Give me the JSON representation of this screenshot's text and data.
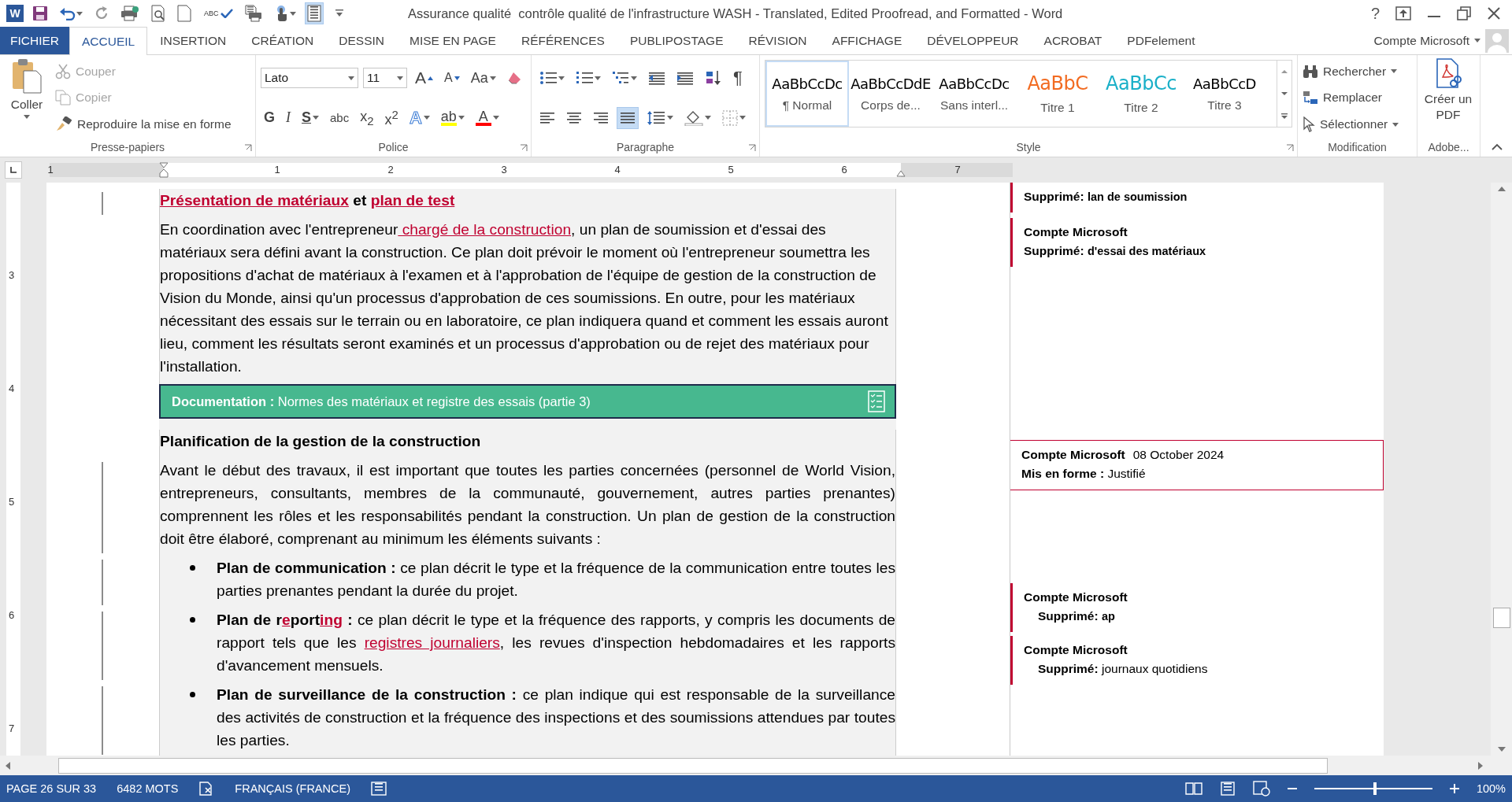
{
  "title_bar": {
    "quick_access": [
      {
        "kind": "word-logo",
        "text": "W",
        "on": false
      },
      {
        "kind": "save",
        "on": false
      },
      {
        "kind": "undo",
        "on": false
      },
      {
        "kind": "redo",
        "on": false
      },
      {
        "kind": "print",
        "on": false
      },
      {
        "kind": "preview",
        "on": false
      },
      {
        "kind": "new",
        "on": false
      },
      {
        "kind": "spelling",
        "text": "ABC",
        "on": false
      },
      {
        "kind": "print-preview",
        "on": false
      },
      {
        "kind": "touch",
        "on": false
      },
      {
        "kind": "layout",
        "on": true
      },
      {
        "kind": "customize",
        "on": false
      }
    ],
    "title": "Assurance qualité  contrôle qualité de l'infrastructure WASH - Translated, Edited Proofread, and Formatted - Word",
    "help": "?"
  },
  "menu_tabs": [
    {
      "label": "FICHIER",
      "kind": "file",
      "selected": false
    },
    {
      "label": "ACCUEIL",
      "kind": "tab",
      "selected": true
    },
    {
      "label": "INSERTION",
      "kind": "tab",
      "selected": false
    },
    {
      "label": "CRÉATION",
      "kind": "tab",
      "selected": false
    },
    {
      "label": "DESSIN",
      "kind": "tab",
      "selected": false
    },
    {
      "label": "MISE EN PAGE",
      "kind": "tab",
      "selected": false
    },
    {
      "label": "RÉFÉRENCES",
      "kind": "tab",
      "selected": false
    },
    {
      "label": "PUBLIPOSTAGE",
      "kind": "tab",
      "selected": false
    },
    {
      "label": "RÉVISION",
      "kind": "tab",
      "selected": false
    },
    {
      "label": "AFFICHAGE",
      "kind": "tab",
      "selected": false
    },
    {
      "label": "DÉVELOPPEUR",
      "kind": "tab",
      "selected": false
    },
    {
      "label": "ACROBAT",
      "kind": "tab",
      "selected": false
    },
    {
      "label": "PDFelement",
      "kind": "tab",
      "selected": false
    }
  ],
  "account": "Compte Microsoft",
  "ribbon": {
    "clipboard": {
      "title": "Presse-papiers",
      "paste": "Coller",
      "items": [
        {
          "kind": "cut",
          "label": "Couper",
          "disabled": true
        },
        {
          "kind": "copy",
          "label": "Copier",
          "disabled": true
        },
        {
          "kind": "format-painter",
          "label": "Reproduire la mise en forme",
          "disabled": false
        }
      ]
    },
    "font": {
      "title": "Police",
      "font_name": "Lato",
      "font_size": "11",
      "tools_top": [
        {
          "kind": "grow",
          "text": "A"
        },
        {
          "kind": "shrink",
          "text": "A"
        },
        {
          "kind": "case",
          "text": "Aa"
        },
        {
          "kind": "clear"
        }
      ],
      "tools_bottom": [
        {
          "kind": "bold",
          "text": "G"
        },
        {
          "kind": "italic",
          "text": "I"
        },
        {
          "kind": "underline",
          "text": "S"
        },
        {
          "kind": "strike",
          "text": "abc"
        },
        {
          "kind": "sub",
          "text": "x$_{2}$"
        },
        {
          "kind": "sup",
          "text": "x$^{2}$"
        },
        {
          "kind": "effects",
          "text": "A"
        },
        {
          "kind": "highlight",
          "text": "ab",
          "color": "#ffff00"
        },
        {
          "kind": "font-color",
          "text": "A",
          "color": "#ff0000"
        }
      ]
    },
    "paragraph": {
      "title": "Paragraphe",
      "tools_top": [
        {
          "kind": "bullets"
        },
        {
          "kind": "numbering"
        },
        {
          "kind": "multilevel"
        },
        {
          "kind": "outdent"
        },
        {
          "kind": "indent"
        },
        {
          "kind": "sort"
        },
        {
          "kind": "pilcrow",
          "text": "¶"
        }
      ],
      "alignment": [
        {
          "kind": "left",
          "selected": false
        },
        {
          "kind": "center",
          "selected": false
        },
        {
          "kind": "right",
          "selected": false
        },
        {
          "kind": "justify",
          "selected": true
        }
      ],
      "tools_bottom": [
        {
          "kind": "line-spacing"
        },
        {
          "kind": "shading"
        },
        {
          "kind": "borders"
        }
      ]
    },
    "styles": {
      "title": "Style",
      "items": [
        {
          "preview": "AaBbCcDc",
          "label": "¶ Normal",
          "color": "#000000",
          "selected": true
        },
        {
          "preview": "AaBbCcDdE",
          "label": "Corps de...",
          "color": "#000000",
          "selected": false
        },
        {
          "preview": "AaBbCcDc",
          "label": "Sans interl...",
          "color": "#000000",
          "selected": false
        },
        {
          "preview": "AaBbC",
          "label": "Titre 1",
          "color": "#f26b21",
          "selected": false
        },
        {
          "preview": "AaBbCc",
          "label": "Titre 2",
          "color": "#1ab0c8",
          "selected": false
        },
        {
          "preview": "AaBbCcD",
          "label": "Titre 3",
          "color": "#000000",
          "selected": false
        }
      ]
    },
    "editing": {
      "title": "Modification",
      "items": [
        {
          "kind": "find",
          "label": "Rechercher"
        },
        {
          "kind": "replace",
          "label": "Remplacer"
        },
        {
          "kind": "select",
          "label": "Sélectionner"
        }
      ]
    },
    "adobe": {
      "title": "Adobe...",
      "button": "Créer un PDF"
    }
  },
  "ruler": {
    "horizontal": [
      "1",
      "1",
      "2",
      "3",
      "4",
      "5",
      "6",
      "7"
    ],
    "vertical": [
      "3",
      "4",
      "5",
      "6",
      "7"
    ]
  },
  "document": {
    "blocks": [
      {
        "kind": "heading",
        "changed": true,
        "segments": [
          {
            "text": "Présentation de matériaux",
            "inserted": true
          },
          {
            "text": " et ",
            "inserted": false
          },
          {
            "text": "plan de test",
            "inserted": true
          }
        ]
      },
      {
        "kind": "paragraph",
        "changed": false,
        "justified": false,
        "segments": [
          {
            "text": "En coordination avec l'entrepreneur",
            "inserted": false
          },
          {
            "text": " chargé de la construction",
            "inserted": true
          },
          {
            "text": ", un plan de soumission et d'essai des matériaux sera défini avant la construction. Ce plan doit prévoir le moment où l'entrepreneur soumettra les propositions d'achat de matériaux à l'examen et à l'approbation de l'équipe de gestion de la construction de Vision du Monde, ainsi qu'un processus d'approbation de ces soumissions. En outre, pour les matériaux nécessitant des essais sur le terrain ou en laboratoire, ce plan indiquera quand et comment les essais auront lieu, comment les résultats seront examinés et un processus d'approbation ou de rejet des matériaux pour l'installation.",
            "inserted": false
          }
        ]
      },
      {
        "kind": "banner",
        "changed": false,
        "text": "**Documentation :** Normes des matériaux et registre des essais (partie 3)"
      },
      {
        "kind": "heading",
        "changed": false,
        "segments": [
          {
            "text": "Planification de la gestion de la construction",
            "inserted": false
          }
        ]
      },
      {
        "kind": "paragraph",
        "changed": true,
        "justified": true,
        "segments": [
          {
            "text": "Avant le début des travaux, il est important que toutes les parties concernées (personnel de World Vision, entrepreneurs, consultants, membres de la communauté, gouvernement, autres parties prenantes) comprennent les rôles et les responsabilités pendant la construction. Un plan de gestion de la construction doit être élaboré, comprenant au minimum les éléments suivants :",
            "inserted": false
          }
        ]
      },
      {
        "kind": "bullet",
        "changed": true,
        "justified": true,
        "segments": [
          {
            "text": "**Plan de communication :** ce plan décrit le type et la fréquence de la communication entre toutes les parties prenantes pendant la durée du projet.",
            "inserted": false
          }
        ]
      },
      {
        "kind": "bullet",
        "changed": true,
        "justified": true,
        "segments": [
          {
            "text": "**Plan de r**",
            "inserted": false
          },
          {
            "text": "**e**",
            "inserted": true
          },
          {
            "text": "**port**",
            "inserted": false
          },
          {
            "text": "**ing**",
            "inserted": true
          },
          {
            "text": " **:** ce plan décrit le type et la fréquence des rapports, y compris les documents de rapport tels que les ",
            "inserted": false
          },
          {
            "text": "registres journaliers",
            "inserted": true
          },
          {
            "text": ", les revues d'inspection hebdomadaires et les rapports d'avancement mensuels.",
            "inserted": false
          }
        ]
      },
      {
        "kind": "bullet",
        "changed": true,
        "justified": true,
        "segments": [
          {
            "text": "**Plan de surveillance de la construction :** ce plan indique qui est responsable de la surveillance des activités de construction et la fréquence des inspections et des soumissions attendues par toutes les parties.",
            "inserted": false
          }
        ]
      }
    ]
  },
  "comments": [
    {
      "kind": "deleted",
      "label": "Supprimé:",
      "text": "lan de soumission",
      "text_bold": true,
      "indented": false,
      "selected": false
    },
    {
      "kind": "deleted",
      "author": "Compte Microsoft",
      "label": "Supprimé:",
      "text": "d'essai des matériaux",
      "text_bold": true,
      "indented": false,
      "selected": false
    },
    {
      "kind": "formatted",
      "author": "Compte Microsoft",
      "date": "08 October 2024",
      "label": "Mis en forme :",
      "text": "Justifié",
      "text_bold": false,
      "indented": false,
      "selected": true
    },
    {
      "kind": "deleted",
      "author": "Compte Microsoft",
      "label": "Supprimé:",
      "text": "ap",
      "text_bold": true,
      "indented": true,
      "selected": false
    },
    {
      "kind": "deleted",
      "author": "Compte Microsoft",
      "label": "Supprimé:",
      "text": "journaux quotidiens",
      "text_bold": false,
      "indented": true,
      "selected": false
    }
  ],
  "status_bar": {
    "page": "PAGE 26 SUR 33",
    "words": "6482 MOTS",
    "language": "FRANÇAIS (FRANCE)",
    "zoom": "100%",
    "zoom_slider": {
      "level": 0.5
    }
  }
}
